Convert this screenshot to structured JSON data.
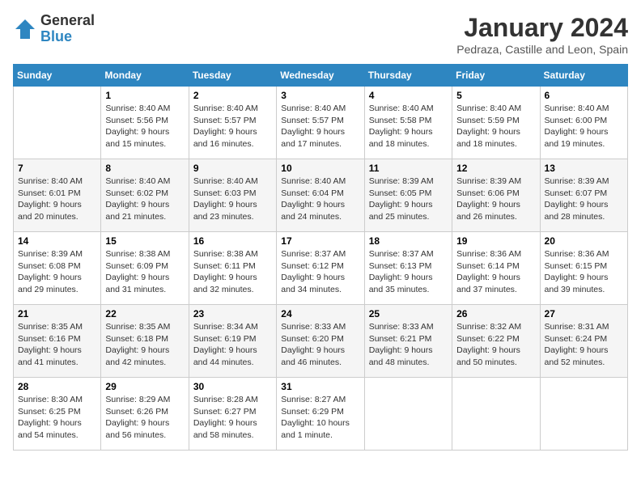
{
  "header": {
    "logo_line1": "General",
    "logo_line2": "Blue",
    "month_year": "January 2024",
    "location": "Pedraza, Castille and Leon, Spain"
  },
  "days_of_week": [
    "Sunday",
    "Monday",
    "Tuesday",
    "Wednesday",
    "Thursday",
    "Friday",
    "Saturday"
  ],
  "weeks": [
    [
      {
        "day": "",
        "sunrise": "",
        "sunset": "",
        "daylight": ""
      },
      {
        "day": "1",
        "sunrise": "Sunrise: 8:40 AM",
        "sunset": "Sunset: 5:56 PM",
        "daylight": "Daylight: 9 hours and 15 minutes."
      },
      {
        "day": "2",
        "sunrise": "Sunrise: 8:40 AM",
        "sunset": "Sunset: 5:57 PM",
        "daylight": "Daylight: 9 hours and 16 minutes."
      },
      {
        "day": "3",
        "sunrise": "Sunrise: 8:40 AM",
        "sunset": "Sunset: 5:57 PM",
        "daylight": "Daylight: 9 hours and 17 minutes."
      },
      {
        "day": "4",
        "sunrise": "Sunrise: 8:40 AM",
        "sunset": "Sunset: 5:58 PM",
        "daylight": "Daylight: 9 hours and 18 minutes."
      },
      {
        "day": "5",
        "sunrise": "Sunrise: 8:40 AM",
        "sunset": "Sunset: 5:59 PM",
        "daylight": "Daylight: 9 hours and 18 minutes."
      },
      {
        "day": "6",
        "sunrise": "Sunrise: 8:40 AM",
        "sunset": "Sunset: 6:00 PM",
        "daylight": "Daylight: 9 hours and 19 minutes."
      }
    ],
    [
      {
        "day": "7",
        "sunrise": "Sunrise: 8:40 AM",
        "sunset": "Sunset: 6:01 PM",
        "daylight": "Daylight: 9 hours and 20 minutes."
      },
      {
        "day": "8",
        "sunrise": "Sunrise: 8:40 AM",
        "sunset": "Sunset: 6:02 PM",
        "daylight": "Daylight: 9 hours and 21 minutes."
      },
      {
        "day": "9",
        "sunrise": "Sunrise: 8:40 AM",
        "sunset": "Sunset: 6:03 PM",
        "daylight": "Daylight: 9 hours and 23 minutes."
      },
      {
        "day": "10",
        "sunrise": "Sunrise: 8:40 AM",
        "sunset": "Sunset: 6:04 PM",
        "daylight": "Daylight: 9 hours and 24 minutes."
      },
      {
        "day": "11",
        "sunrise": "Sunrise: 8:39 AM",
        "sunset": "Sunset: 6:05 PM",
        "daylight": "Daylight: 9 hours and 25 minutes."
      },
      {
        "day": "12",
        "sunrise": "Sunrise: 8:39 AM",
        "sunset": "Sunset: 6:06 PM",
        "daylight": "Daylight: 9 hours and 26 minutes."
      },
      {
        "day": "13",
        "sunrise": "Sunrise: 8:39 AM",
        "sunset": "Sunset: 6:07 PM",
        "daylight": "Daylight: 9 hours and 28 minutes."
      }
    ],
    [
      {
        "day": "14",
        "sunrise": "Sunrise: 8:39 AM",
        "sunset": "Sunset: 6:08 PM",
        "daylight": "Daylight: 9 hours and 29 minutes."
      },
      {
        "day": "15",
        "sunrise": "Sunrise: 8:38 AM",
        "sunset": "Sunset: 6:09 PM",
        "daylight": "Daylight: 9 hours and 31 minutes."
      },
      {
        "day": "16",
        "sunrise": "Sunrise: 8:38 AM",
        "sunset": "Sunset: 6:11 PM",
        "daylight": "Daylight: 9 hours and 32 minutes."
      },
      {
        "day": "17",
        "sunrise": "Sunrise: 8:37 AM",
        "sunset": "Sunset: 6:12 PM",
        "daylight": "Daylight: 9 hours and 34 minutes."
      },
      {
        "day": "18",
        "sunrise": "Sunrise: 8:37 AM",
        "sunset": "Sunset: 6:13 PM",
        "daylight": "Daylight: 9 hours and 35 minutes."
      },
      {
        "day": "19",
        "sunrise": "Sunrise: 8:36 AM",
        "sunset": "Sunset: 6:14 PM",
        "daylight": "Daylight: 9 hours and 37 minutes."
      },
      {
        "day": "20",
        "sunrise": "Sunrise: 8:36 AM",
        "sunset": "Sunset: 6:15 PM",
        "daylight": "Daylight: 9 hours and 39 minutes."
      }
    ],
    [
      {
        "day": "21",
        "sunrise": "Sunrise: 8:35 AM",
        "sunset": "Sunset: 6:16 PM",
        "daylight": "Daylight: 9 hours and 41 minutes."
      },
      {
        "day": "22",
        "sunrise": "Sunrise: 8:35 AM",
        "sunset": "Sunset: 6:18 PM",
        "daylight": "Daylight: 9 hours and 42 minutes."
      },
      {
        "day": "23",
        "sunrise": "Sunrise: 8:34 AM",
        "sunset": "Sunset: 6:19 PM",
        "daylight": "Daylight: 9 hours and 44 minutes."
      },
      {
        "day": "24",
        "sunrise": "Sunrise: 8:33 AM",
        "sunset": "Sunset: 6:20 PM",
        "daylight": "Daylight: 9 hours and 46 minutes."
      },
      {
        "day": "25",
        "sunrise": "Sunrise: 8:33 AM",
        "sunset": "Sunset: 6:21 PM",
        "daylight": "Daylight: 9 hours and 48 minutes."
      },
      {
        "day": "26",
        "sunrise": "Sunrise: 8:32 AM",
        "sunset": "Sunset: 6:22 PM",
        "daylight": "Daylight: 9 hours and 50 minutes."
      },
      {
        "day": "27",
        "sunrise": "Sunrise: 8:31 AM",
        "sunset": "Sunset: 6:24 PM",
        "daylight": "Daylight: 9 hours and 52 minutes."
      }
    ],
    [
      {
        "day": "28",
        "sunrise": "Sunrise: 8:30 AM",
        "sunset": "Sunset: 6:25 PM",
        "daylight": "Daylight: 9 hours and 54 minutes."
      },
      {
        "day": "29",
        "sunrise": "Sunrise: 8:29 AM",
        "sunset": "Sunset: 6:26 PM",
        "daylight": "Daylight: 9 hours and 56 minutes."
      },
      {
        "day": "30",
        "sunrise": "Sunrise: 8:28 AM",
        "sunset": "Sunset: 6:27 PM",
        "daylight": "Daylight: 9 hours and 58 minutes."
      },
      {
        "day": "31",
        "sunrise": "Sunrise: 8:27 AM",
        "sunset": "Sunset: 6:29 PM",
        "daylight": "Daylight: 10 hours and 1 minute."
      },
      {
        "day": "",
        "sunrise": "",
        "sunset": "",
        "daylight": ""
      },
      {
        "day": "",
        "sunrise": "",
        "sunset": "",
        "daylight": ""
      },
      {
        "day": "",
        "sunrise": "",
        "sunset": "",
        "daylight": ""
      }
    ]
  ]
}
